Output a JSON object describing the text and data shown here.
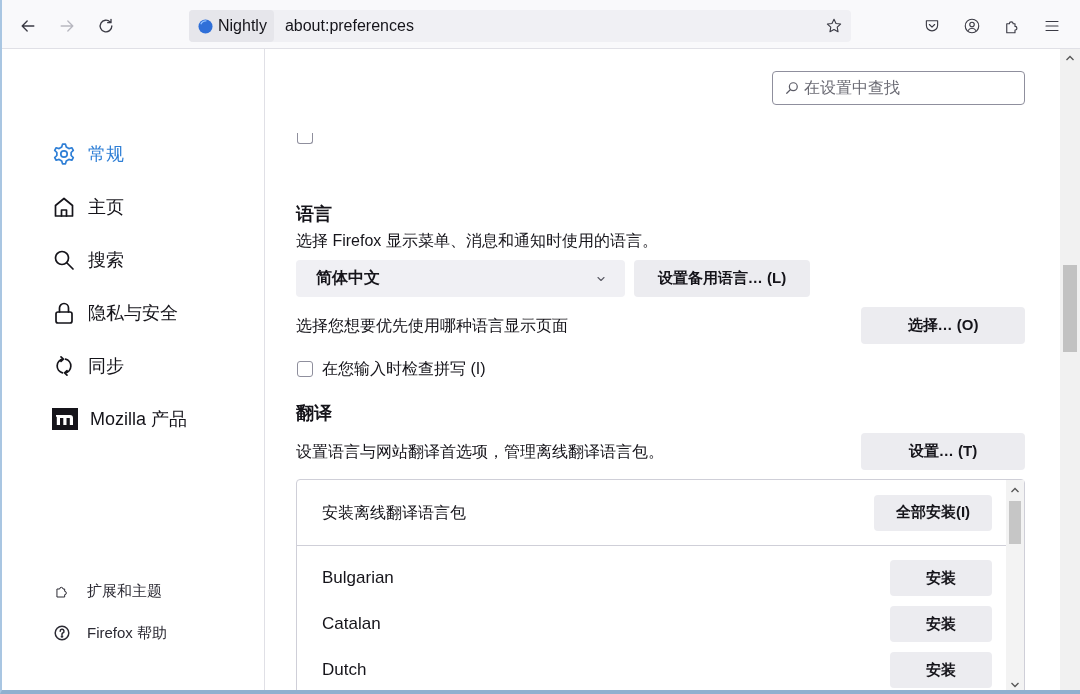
{
  "toolbar": {
    "nav_buttons": [
      {
        "disabled": false
      },
      {
        "disabled": true
      },
      {
        "disabled": false
      }
    ],
    "url_bar": {
      "identity": "Nightly",
      "url": "about:preferences"
    }
  },
  "sidebar": {
    "items": [
      {
        "label": "常规",
        "selected": true
      },
      {
        "label": "主页",
        "selected": false
      },
      {
        "label": "搜索",
        "selected": false
      },
      {
        "label": "隐私与安全",
        "selected": false
      },
      {
        "label": "同步",
        "selected": false
      },
      {
        "label": "Mozilla 产品",
        "selected": false
      }
    ],
    "footer_links": [
      {
        "label": "扩展和主题"
      },
      {
        "label": "Firefox 帮助"
      }
    ]
  },
  "search": {
    "placeholder": "在设置中查找"
  },
  "clipped_checkbox": {
    "checked": false
  },
  "language": {
    "heading": "语言",
    "description": "选择 Firefox 显示菜单、消息和通知时使用的语言。",
    "dropdown": {
      "value": "简体中文"
    },
    "alternate_button": "设置备用语言… (L)",
    "page_language": {
      "label": "选择您想要优先使用哪种语言显示页面",
      "button": "选择… (O)"
    },
    "spellcheck": {
      "label": "在您输入时检查拼写 (I)",
      "checked": false
    }
  },
  "translation": {
    "heading": "翻译",
    "description": "设置语言与网站翻译首选项，管理离线翻译语言包。",
    "button": "设置… (T)",
    "packs": {
      "title": "安装离线翻译语言包",
      "install_all_button": "全部安装(I)",
      "rows": [
        {
          "language": "Bulgarian",
          "button": "安装"
        },
        {
          "language": "Catalan",
          "button": "安装"
        },
        {
          "language": "Dutch",
          "button": "安装"
        }
      ]
    }
  }
}
